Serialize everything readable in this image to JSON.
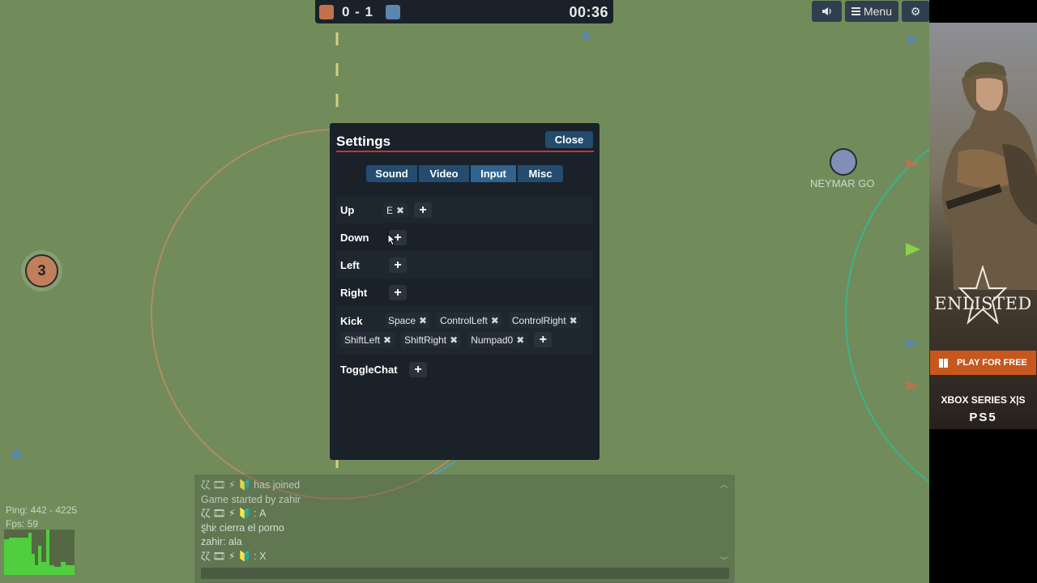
{
  "scoreboard": {
    "score": "0 - 1",
    "timer": "00:36",
    "red_color": "#c2714f",
    "blue_color": "#5b86b0"
  },
  "top_menu": {
    "menu_label": "Menu"
  },
  "field": {
    "grass_color": "#718c5a",
    "player_number": "3",
    "opponent_name": "NEYMAR GO"
  },
  "settings": {
    "title": "Settings",
    "close_label": "Close",
    "tabs": [
      "Sound",
      "Video",
      "Input",
      "Misc"
    ],
    "active_tab": "Input",
    "bindings": {
      "up": {
        "label": "Up",
        "keys": [
          "E"
        ]
      },
      "down": {
        "label": "Down",
        "keys": []
      },
      "left": {
        "label": "Left",
        "keys": []
      },
      "right": {
        "label": "Right",
        "keys": []
      },
      "kick": {
        "label": "Kick",
        "keys": [
          "Space",
          "ControlLeft",
          "ControlRight",
          "ShiftLeft",
          "ShiftRight",
          "Numpad0"
        ]
      },
      "toggle_chat": {
        "label": "ToggleChat",
        "keys": []
      }
    },
    "add_glyph": "+",
    "remove_glyph": "✖"
  },
  "stats": {
    "ping": "Ping: 442 - 4225",
    "fps": "Fps: 59"
  },
  "chat": {
    "lines": [
      "ζζ 🎞 ⚡ 🔰 has joined",
      "Game started by zahir",
      "ζζ 🎞 ⚡ 🔰 : A",
      "ȿ̈hi̷: cierra el porno",
      "zahir: ala",
      "ζζ 🎞 ⚡ 🔰 : X"
    ]
  },
  "ad": {
    "brand": "ENLISTED",
    "cta": "PLAY FOR FREE",
    "platform_1": "XBOX SERIES X|S",
    "platform_2": "PS5"
  }
}
